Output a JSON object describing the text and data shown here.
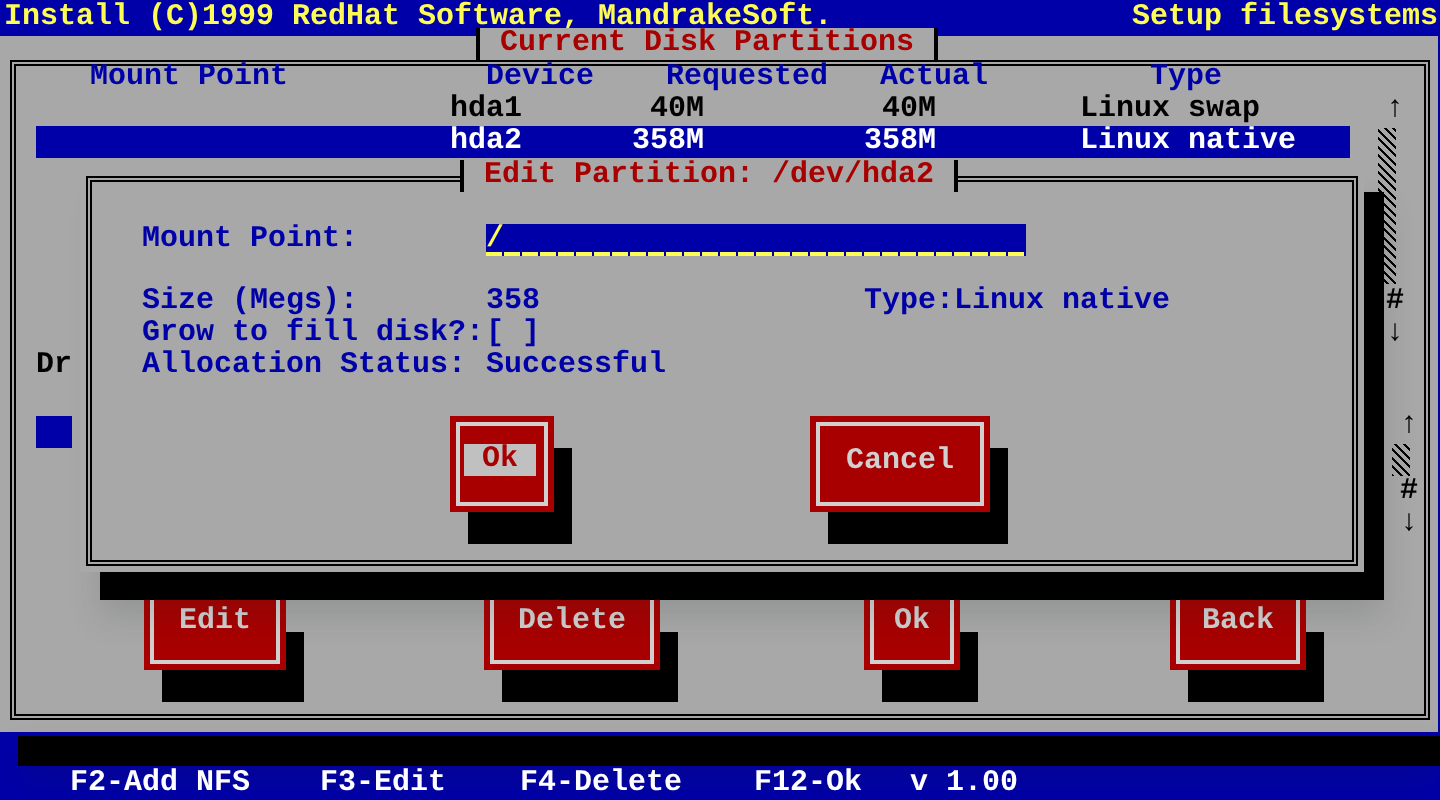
{
  "header": {
    "title": "Install (C)1999 RedHat Software, MandrakeSoft.",
    "section": "Setup filesystems"
  },
  "partitions_window": {
    "title": "Current Disk Partitions",
    "columns": [
      "Mount Point",
      "Device",
      "Requested",
      "Actual",
      "Type"
    ],
    "rows": [
      {
        "device": "hda1",
        "requested": "40M",
        "actual": "40M",
        "type": "Linux swap",
        "selected": false
      },
      {
        "device": "hda2",
        "requested": "358M",
        "actual": "358M",
        "type": "Linux native",
        "selected": true
      }
    ],
    "scrollbar": {
      "up": "↑",
      "thumb": "#",
      "down": "↓"
    },
    "drives_label": "Dr",
    "drives_scrollbar": {
      "up": "↑",
      "thumb": "#",
      "down": "↓"
    },
    "buttons": [
      {
        "label": "Edit"
      },
      {
        "label": "Delete"
      },
      {
        "label": "Ok"
      },
      {
        "label": "Back"
      }
    ]
  },
  "edit_dialog": {
    "title": "Edit Partition: /dev/hda2",
    "mount_point": {
      "label": "Mount Point:",
      "value": "/"
    },
    "size": {
      "label": "Size (Megs):",
      "value": "358"
    },
    "type": "Type:Linux native",
    "grow": {
      "label": "Grow to fill disk?:",
      "box": "[ ]",
      "checked": false
    },
    "allocation": {
      "label": "Allocation Status:",
      "value": "Successful"
    },
    "buttons": [
      {
        "label": "Ok",
        "focused": true
      },
      {
        "label": "Cancel",
        "focused": false
      }
    ]
  },
  "status_bar": [
    "F2-Add NFS",
    "F3-Edit",
    "F4-Delete",
    "F12-Ok",
    "v 1.00"
  ]
}
